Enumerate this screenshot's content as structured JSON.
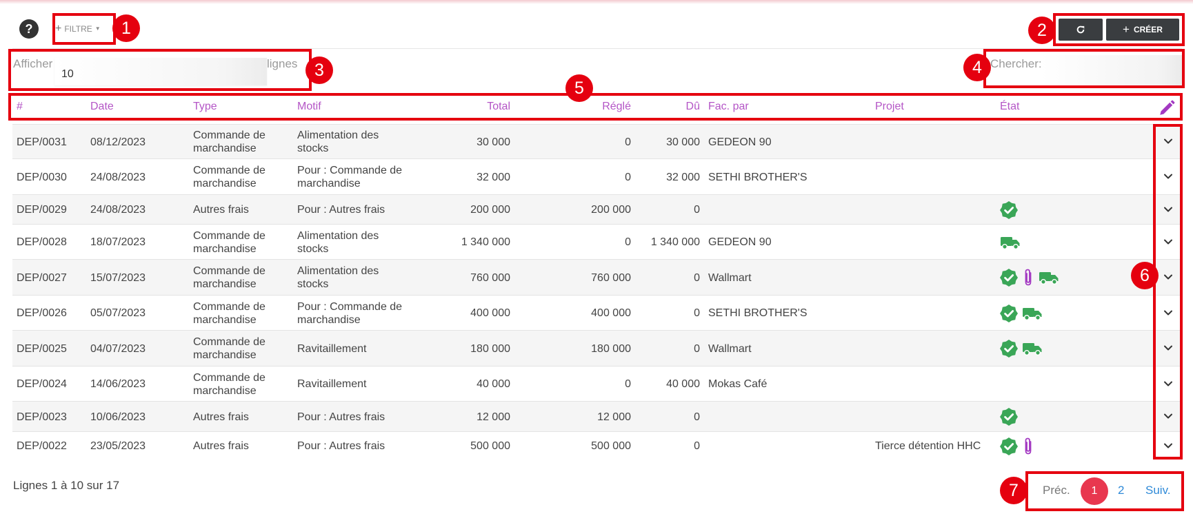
{
  "toolbar": {
    "help_label": "?",
    "filter_plus": "+",
    "filter_label": "FILTRE",
    "filter_caret": "▼",
    "refresh_icon": "refresh-icon",
    "create_plus": "+",
    "create_label": "CRÉER"
  },
  "length_control": {
    "prefix": "Afficher",
    "value": "10",
    "suffix": "lignes"
  },
  "search": {
    "label": "Chercher:",
    "value": ""
  },
  "table": {
    "columns": [
      "#",
      "Date",
      "Type",
      "Motif",
      "Total",
      "Réglé",
      "Dû",
      "Fac. par",
      "Projet",
      "État"
    ],
    "rows": [
      {
        "id": "DEP/0031",
        "date": "08/12/2023",
        "type1": "Commande de",
        "type2": "marchandise",
        "motif1": "Alimentation des",
        "motif2": "stocks",
        "total": "30 000",
        "regle": "0",
        "du": "30 000",
        "facpar": "GEDEON 90",
        "projet": "",
        "etat": []
      },
      {
        "id": "DEP/0030",
        "date": "24/08/2023",
        "type1": "Commande de",
        "type2": "marchandise",
        "motif1": "Pour : Commande de",
        "motif2": "marchandise",
        "total": "32 000",
        "regle": "0",
        "du": "32 000",
        "facpar": "SETHI BROTHER'S",
        "projet": "",
        "etat": []
      },
      {
        "id": "DEP/0029",
        "date": "24/08/2023",
        "type1": "Autres frais",
        "type2": "",
        "motif1": "Pour : Autres frais",
        "motif2": "",
        "total": "200 000",
        "regle": "200 000",
        "du": "0",
        "facpar": "",
        "projet": "",
        "etat": [
          "verified-icon"
        ]
      },
      {
        "id": "DEP/0028",
        "date": "18/07/2023",
        "type1": "Commande de",
        "type2": "marchandise",
        "motif1": "Alimentation des",
        "motif2": "stocks",
        "total": "1 340 000",
        "regle": "0",
        "du": "1 340 000",
        "facpar": "GEDEON 90",
        "projet": "",
        "etat": [
          "truck-icon"
        ]
      },
      {
        "id": "DEP/0027",
        "date": "15/07/2023",
        "type1": "Commande de",
        "type2": "marchandise",
        "motif1": "Alimentation des",
        "motif2": "stocks",
        "total": "760 000",
        "regle": "760 000",
        "du": "0",
        "facpar": "Wallmart",
        "projet": "",
        "etat": [
          "verified-icon",
          "paperclip-icon",
          "truck-icon"
        ]
      },
      {
        "id": "DEP/0026",
        "date": "05/07/2023",
        "type1": "Commande de",
        "type2": "marchandise",
        "motif1": "Pour : Commande de",
        "motif2": "marchandise",
        "total": "400 000",
        "regle": "400 000",
        "du": "0",
        "facpar": "SETHI BROTHER'S",
        "projet": "",
        "etat": [
          "verified-icon",
          "truck-icon"
        ]
      },
      {
        "id": "DEP/0025",
        "date": "04/07/2023",
        "type1": "Commande de",
        "type2": "marchandise",
        "motif1": "Ravitaillement",
        "motif2": "",
        "total": "180 000",
        "regle": "180 000",
        "du": "0",
        "facpar": "Wallmart",
        "projet": "",
        "etat": [
          "verified-icon",
          "truck-icon"
        ]
      },
      {
        "id": "DEP/0024",
        "date": "14/06/2023",
        "type1": "Commande de",
        "type2": "marchandise",
        "motif1": "Ravitaillement",
        "motif2": "",
        "total": "40 000",
        "regle": "0",
        "du": "40 000",
        "facpar": "Mokas Café",
        "projet": "",
        "etat": []
      },
      {
        "id": "DEP/0023",
        "date": "10/06/2023",
        "type1": "Autres frais",
        "type2": "",
        "motif1": "Pour : Autres frais",
        "motif2": "",
        "total": "12 000",
        "regle": "12 000",
        "du": "0",
        "facpar": "",
        "projet": "",
        "etat": [
          "verified-icon"
        ]
      },
      {
        "id": "DEP/0022",
        "date": "23/05/2023",
        "type1": "Autres frais",
        "type2": "",
        "motif1": "Pour : Autres frais",
        "motif2": "",
        "total": "500 000",
        "regle": "500 000",
        "du": "0",
        "facpar": "",
        "projet": "Tierce détention HHC",
        "etat": [
          "verified-icon",
          "paperclip-icon"
        ]
      }
    ]
  },
  "pagination": {
    "info": "Lignes 1 à 10 sur 17",
    "prev": "Préc.",
    "pages": [
      "1",
      "2"
    ],
    "current": "1",
    "next": "Suiv."
  },
  "annotations": [
    "1",
    "2",
    "3",
    "4",
    "5",
    "6",
    "7"
  ],
  "colors": {
    "accent": "#b455c6",
    "annotation_red": "#e5000f",
    "success_green": "#3aa657",
    "active_page": "#e8374f",
    "link_blue": "#2f8ad8",
    "dark_button": "#3a3d40"
  }
}
